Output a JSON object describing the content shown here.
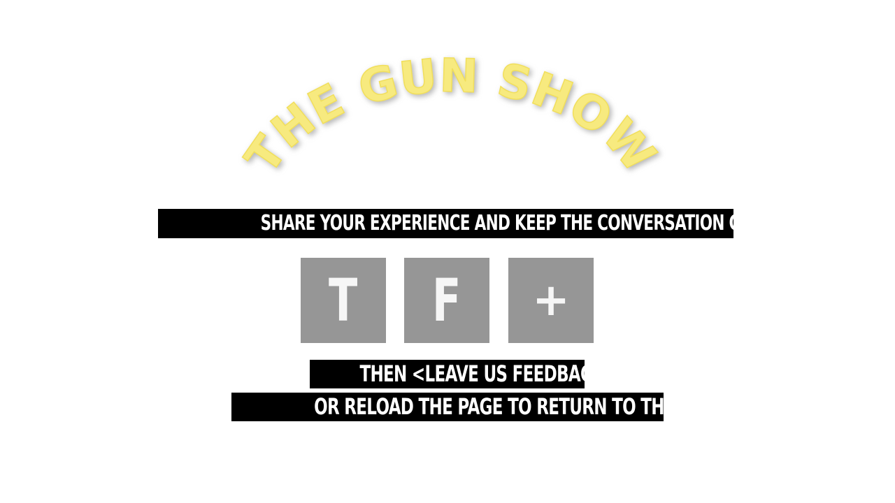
{
  "logo": {
    "text": "*THE GUN SHOW*",
    "color": "#f7ea7f"
  },
  "share_prompt": "SHARE YOUR EXPERIENCE AND KEEP THE CONVERSATION GOING:",
  "share_buttons": [
    {
      "glyph": "T",
      "icon": "twitter-icon"
    },
    {
      "glyph": "F",
      "icon": "facebook-icon"
    },
    {
      "glyph": "+",
      "icon": "plus-icon"
    }
  ],
  "followup": {
    "then_prefix": "THEN ",
    "feedback_link": "<LEAVE US FEEDBACK>",
    "reload_text": "OR RELOAD THE PAGE TO RETURN TO THE SHOW."
  },
  "colors": {
    "background": "#ffffff",
    "strip": "#000000",
    "button": "#969696",
    "logo": "#f7ea7f"
  }
}
